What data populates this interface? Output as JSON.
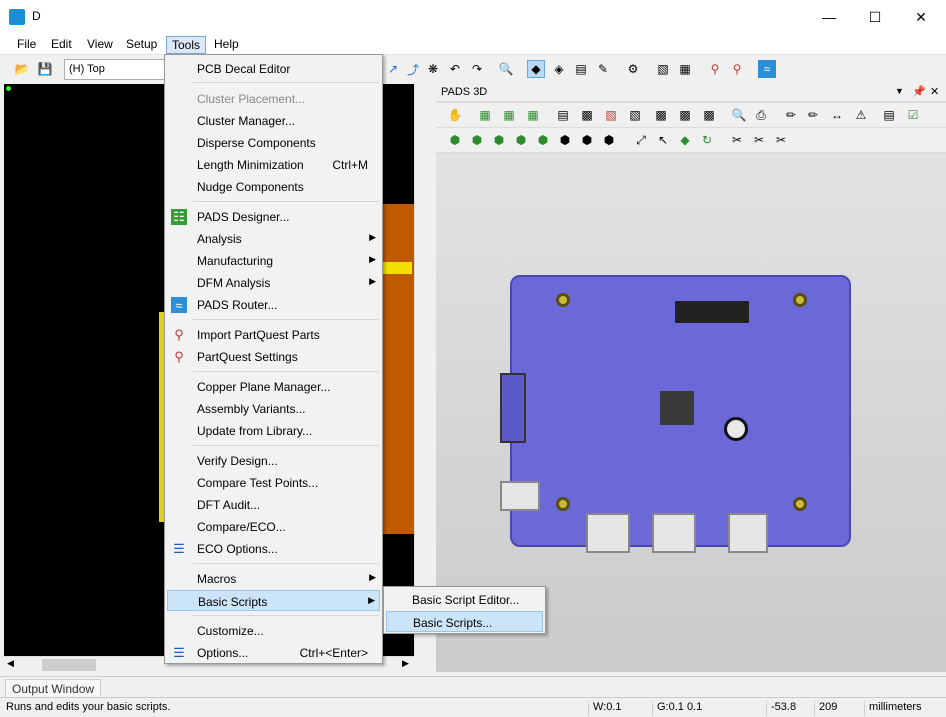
{
  "window": {
    "title": "D"
  },
  "menubar": [
    "File",
    "Edit",
    "View",
    "Setup",
    "Tools",
    "Help"
  ],
  "toolbar": {
    "layer_value": "(H) Top"
  },
  "panel_3d": {
    "title": "PADS 3D"
  },
  "output": {
    "tab_label": "Output Window"
  },
  "status": {
    "message": "Runs and edits your basic scripts.",
    "width": "W:0.1",
    "grid": "G:0.1 0.1",
    "x": "-53.8",
    "y": "209",
    "units": "millimeters"
  },
  "tools_menu": {
    "items": [
      {
        "label": "PCB Decal Editor",
        "shortcut": "",
        "submenu": false,
        "disabled": false,
        "icon": ""
      },
      {
        "label": "Cluster Placement...",
        "shortcut": "",
        "submenu": false,
        "disabled": true,
        "icon": ""
      },
      {
        "label": "Cluster Manager...",
        "shortcut": "",
        "submenu": false,
        "disabled": false,
        "icon": ""
      },
      {
        "label": "Disperse Components",
        "shortcut": "",
        "submenu": false,
        "disabled": false,
        "icon": ""
      },
      {
        "label": "Length Minimization",
        "shortcut": "Ctrl+M",
        "submenu": false,
        "disabled": false,
        "icon": ""
      },
      {
        "label": "Nudge Components",
        "shortcut": "",
        "submenu": false,
        "disabled": false,
        "icon": ""
      },
      {
        "label": "PADS Designer...",
        "shortcut": "",
        "submenu": false,
        "disabled": false,
        "icon": "pads-designer-icon"
      },
      {
        "label": "Analysis",
        "shortcut": "",
        "submenu": true,
        "disabled": false,
        "icon": ""
      },
      {
        "label": "Manufacturing",
        "shortcut": "",
        "submenu": true,
        "disabled": false,
        "icon": ""
      },
      {
        "label": "DFM Analysis",
        "shortcut": "",
        "submenu": true,
        "disabled": false,
        "icon": ""
      },
      {
        "label": "PADS Router...",
        "shortcut": "",
        "submenu": false,
        "disabled": false,
        "icon": "pads-router-icon"
      },
      {
        "label": "Import PartQuest Parts",
        "shortcut": "",
        "submenu": false,
        "disabled": false,
        "icon": "partquest-icon"
      },
      {
        "label": "PartQuest Settings",
        "shortcut": "",
        "submenu": false,
        "disabled": false,
        "icon": "partquest-settings-icon"
      },
      {
        "label": "Copper Plane Manager...",
        "shortcut": "",
        "submenu": false,
        "disabled": false,
        "icon": ""
      },
      {
        "label": "Assembly Variants...",
        "shortcut": "",
        "submenu": false,
        "disabled": false,
        "icon": ""
      },
      {
        "label": "Update from Library...",
        "shortcut": "",
        "submenu": false,
        "disabled": false,
        "icon": ""
      },
      {
        "label": "Verify Design...",
        "shortcut": "",
        "submenu": false,
        "disabled": false,
        "icon": ""
      },
      {
        "label": "Compare Test Points...",
        "shortcut": "",
        "submenu": false,
        "disabled": false,
        "icon": ""
      },
      {
        "label": "DFT Audit...",
        "shortcut": "",
        "submenu": false,
        "disabled": false,
        "icon": ""
      },
      {
        "label": "Compare/ECO...",
        "shortcut": "",
        "submenu": false,
        "disabled": false,
        "icon": ""
      },
      {
        "label": "ECO Options...",
        "shortcut": "",
        "submenu": false,
        "disabled": false,
        "icon": "eco-options-icon"
      },
      {
        "label": "Macros",
        "shortcut": "",
        "submenu": true,
        "disabled": false,
        "icon": ""
      },
      {
        "label": "Basic Scripts",
        "shortcut": "",
        "submenu": true,
        "disabled": false,
        "icon": ""
      },
      {
        "label": "Customize...",
        "shortcut": "",
        "submenu": false,
        "disabled": false,
        "icon": ""
      },
      {
        "label": "Options...",
        "shortcut": "Ctrl+<Enter>",
        "submenu": false,
        "disabled": false,
        "icon": "options-icon"
      }
    ]
  },
  "basic_scripts_submenu": {
    "items": [
      "Basic Script Editor...",
      "Basic Scripts..."
    ]
  }
}
